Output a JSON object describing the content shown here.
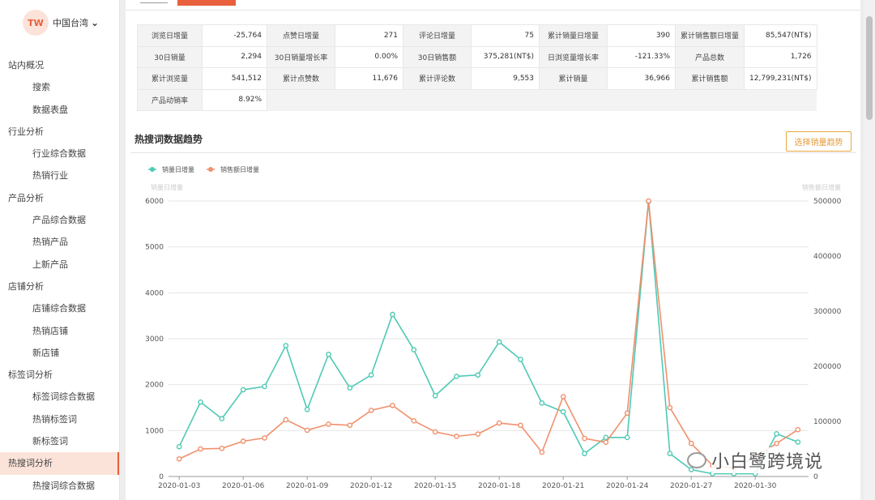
{
  "region": {
    "code": "TW",
    "name": "中国台湾"
  },
  "menu": [
    {
      "label": "站内概况",
      "level": "group"
    },
    {
      "label": "搜索",
      "level": "sub"
    },
    {
      "label": "数据表盘",
      "level": "sub"
    },
    {
      "label": "行业分析",
      "level": "group"
    },
    {
      "label": "行业综合数据",
      "level": "sub"
    },
    {
      "label": "热销行业",
      "level": "sub"
    },
    {
      "label": "产品分析",
      "level": "group"
    },
    {
      "label": "产品综合数据",
      "level": "sub"
    },
    {
      "label": "热销产品",
      "level": "sub"
    },
    {
      "label": "上新产品",
      "level": "sub"
    },
    {
      "label": "店铺分析",
      "level": "group"
    },
    {
      "label": "店铺综合数据",
      "level": "sub"
    },
    {
      "label": "热销店铺",
      "level": "sub"
    },
    {
      "label": "新店铺",
      "level": "sub"
    },
    {
      "label": "标签词分析",
      "level": "group"
    },
    {
      "label": "标签词综合数据",
      "level": "sub"
    },
    {
      "label": "热销标签词",
      "level": "sub"
    },
    {
      "label": "新标签词",
      "level": "sub"
    },
    {
      "label": "热搜词分析",
      "level": "group",
      "active": true
    },
    {
      "label": "热搜词综合数据",
      "level": "sub"
    }
  ],
  "stats": [
    [
      [
        "浏览日增量",
        "-25,764"
      ],
      [
        "点赞日增量",
        "271"
      ],
      [
        "评论日增量",
        "75"
      ],
      [
        "累计销量日增量",
        "390"
      ],
      [
        "累计销售额日增量",
        "85,547(NT$)"
      ]
    ],
    [
      [
        "30日销量",
        "2,294"
      ],
      [
        "30日销量增长率",
        "0.00%"
      ],
      [
        "30日销售额",
        "375,281(NT$)"
      ],
      [
        "日浏览量增长率",
        "-121.33%"
      ],
      [
        "产品总数",
        "1,726"
      ]
    ],
    [
      [
        "累计浏览量",
        "541,512"
      ],
      [
        "累计点赞数",
        "11,676"
      ],
      [
        "累计评论数",
        "9,553"
      ],
      [
        "累计销量",
        "36,966"
      ],
      [
        "累计销售额",
        "12,799,231(NT$)"
      ]
    ],
    [
      [
        "产品动销率",
        "8.92%"
      ]
    ]
  ],
  "section": {
    "title": "热搜词数据趋势",
    "button": "选择销量趋势"
  },
  "watermark": "小白鹭跨境说",
  "colors": {
    "accent": "#e8603c",
    "teal": "#4ec9b4",
    "salmon": "#f0906c"
  },
  "chart_data": {
    "type": "line",
    "x": [
      "2020-01-03",
      "2020-01-04",
      "2020-01-05",
      "2020-01-06",
      "2020-01-07",
      "2020-01-08",
      "2020-01-09",
      "2020-01-10",
      "2020-01-11",
      "2020-01-12",
      "2020-01-13",
      "2020-01-14",
      "2020-01-15",
      "2020-01-16",
      "2020-01-17",
      "2020-01-18",
      "2020-01-19",
      "2020-01-20",
      "2020-01-21",
      "2020-01-22",
      "2020-01-23",
      "2020-01-24",
      "2020-01-25",
      "2020-01-26",
      "2020-01-27",
      "2020-01-28",
      "2020-01-29",
      "2020-01-30",
      "2020-01-31",
      "2020-02-01"
    ],
    "x_tick_labels": [
      "2020-01-03",
      "2020-01-06",
      "2020-01-09",
      "2020-01-12",
      "2020-01-15",
      "2020-01-18",
      "2020-01-21",
      "2020-01-24",
      "2020-01-27",
      "2020-01-30"
    ],
    "series": [
      {
        "name": "销量日增量",
        "axis": "left",
        "color": "#4ec9b4",
        "values": [
          650,
          1620,
          1260,
          1890,
          1960,
          2850,
          1460,
          2660,
          1930,
          2210,
          3530,
          2760,
          1760,
          2180,
          2210,
          2930,
          2550,
          1600,
          1410,
          500,
          850,
          850,
          5990,
          500,
          150,
          60,
          60,
          60,
          930,
          750
        ]
      },
      {
        "name": "销售额日增量",
        "axis": "right",
        "color": "#f0906c",
        "values": [
          32000,
          50000,
          51000,
          64000,
          70000,
          103000,
          84000,
          95000,
          93000,
          120000,
          129000,
          101000,
          81000,
          73000,
          77000,
          97000,
          93000,
          44000,
          145000,
          69000,
          62000,
          115000,
          500000,
          125000,
          60000,
          20000,
          15000,
          35000,
          60000,
          85000
        ]
      }
    ],
    "yleft_label": "销量日增量",
    "yleft_lim": [
      0,
      6000
    ],
    "yleft_ticks": [
      0,
      1000,
      2000,
      3000,
      4000,
      5000,
      6000
    ],
    "yright_label": "销售额日增量",
    "yright_lim": [
      0,
      500000
    ],
    "yright_ticks": [
      0,
      100000,
      200000,
      300000,
      400000,
      500000
    ],
    "legend_position": "top-left",
    "grid": true
  }
}
